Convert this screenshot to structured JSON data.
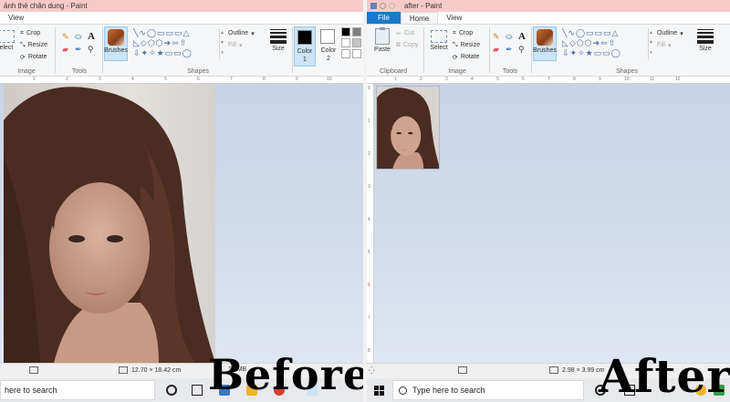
{
  "left": {
    "title": "ảnh thẻ chân dung - Paint",
    "tabs": [
      "View"
    ],
    "ribbon": {
      "groups": {
        "image": "Image",
        "tools": "Tools",
        "shapes": "Shapes"
      },
      "select_label": "elect",
      "crop_label": "Crop",
      "resize_label": "Resize",
      "rotate_label": "Rotate",
      "brushes_label": "Brushes",
      "outline_label": "Outline",
      "fill_label": "Fill",
      "size_label": "Size",
      "color1_label": "Color",
      "color1_num": "1",
      "color2_label": "Color",
      "color2_num": "2"
    },
    "ruler_marks": [
      "1",
      "2",
      "3",
      "4",
      "5",
      "6",
      "7",
      "8",
      "9",
      "10"
    ],
    "status": {
      "dimensions": "12.70 × 18.42 cm",
      "size": "1.0MB"
    },
    "taskbar": {
      "search_text": "here to search"
    },
    "caption": "Before"
  },
  "right": {
    "title": "after - Paint",
    "tabs": [
      "File",
      "Home",
      "View"
    ],
    "ribbon": {
      "groups": {
        "clipboard": "Clipboard",
        "image": "Image",
        "tools": "Tools",
        "shapes": "Shapes"
      },
      "paste_label": "Paste",
      "cut_label": "Cut",
      "copy_label": "Copy",
      "select_label": "Select",
      "crop_label": "Crop",
      "resize_label": "Resize",
      "rotate_label": "Rotate",
      "brushes_label": "Brushes",
      "outline_label": "Outline",
      "fill_label": "Fill",
      "size_label": "Size"
    },
    "ruler_marks": [
      "1",
      "2",
      "3",
      "4",
      "5",
      "6",
      "7",
      "8",
      "9",
      "10",
      "11",
      "12"
    ],
    "status": {
      "dimensions": "2.98 × 3.99 cm"
    },
    "taskbar": {
      "search_text": "Type here to search"
    },
    "caption": "After"
  },
  "colors": {
    "titlebar": "#f7c9c9",
    "file_tab": "#1979ca",
    "canvas": "#c8d4e6",
    "selected_tool": "#cce4f7"
  },
  "icons": [
    "save-icon",
    "undo-icon",
    "redo-icon",
    "paste-icon",
    "cut-icon",
    "copy-icon",
    "select-icon",
    "crop-icon",
    "resize-icon",
    "rotate-icon",
    "pencil-icon",
    "fill-bucket-icon",
    "text-icon",
    "eraser-icon",
    "color-picker-icon",
    "magnifier-icon",
    "brushes-icon",
    "size-icon",
    "windows-start-icon",
    "search-icon",
    "cortana-icon",
    "task-view-icon"
  ]
}
